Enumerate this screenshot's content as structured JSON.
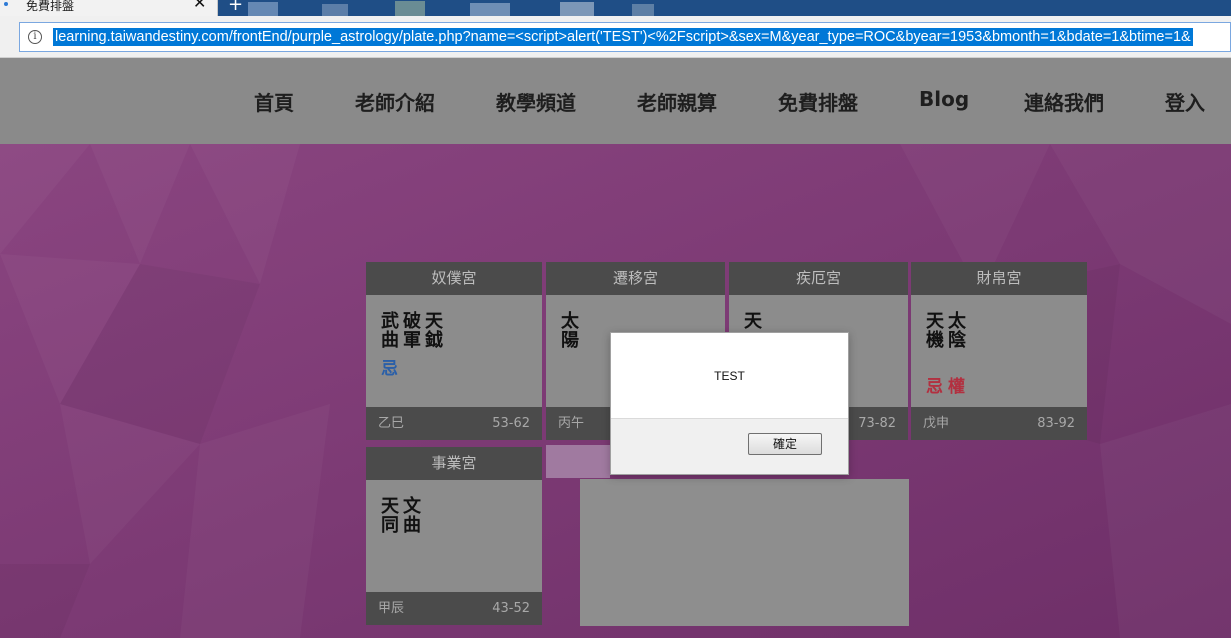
{
  "browser": {
    "tab_title": "免費排盤",
    "tab_close": "✕",
    "new_tab": "+",
    "url": "learning.taiwandestiny.com/frontEnd/purple_astrology/plate.php?name=<script>alert('TEST')<%2Fscript>&sex=M&year_type=ROC&byear=1953&bmonth=1&bdate=1&btime=1&"
  },
  "nav": {
    "items": [
      "首頁",
      "老師介紹",
      "教學頻道",
      "老師親算",
      "免費排盤",
      "Blog",
      "連絡我們",
      "登入"
    ]
  },
  "palaces": [
    {
      "name": "奴僕宮",
      "stars": [
        "武曲",
        "破軍",
        "天鉞"
      ],
      "mutations": [
        "忌"
      ],
      "mutation_color": "blue",
      "ganzhi": "乙巳",
      "ages": "53-62"
    },
    {
      "name": "遷移宮",
      "stars": [
        "太陽"
      ],
      "mutations": [],
      "ganzhi": "丙午",
      "ages": ""
    },
    {
      "name": "疾厄宮",
      "stars": [
        "天"
      ],
      "mutations": [],
      "ganzhi": "",
      "ages": "73-82"
    },
    {
      "name": "財帛宮",
      "stars": [
        "天機",
        "太陰"
      ],
      "mutations": [
        "忌",
        "權"
      ],
      "mutation_color": "red",
      "ganzhi": "戊申",
      "ages": "83-92"
    },
    {
      "name": "事業宮",
      "stars": [
        "天同",
        "文曲"
      ],
      "mutations": [],
      "ganzhi": "甲辰",
      "ages": "43-52"
    }
  ],
  "dialog": {
    "message": "TEST",
    "ok_label": "確定"
  },
  "colors": {
    "background": "#7a3a72",
    "nav": "#8a8a8a",
    "cell": "#8c8c8c",
    "cell_bar": "#4b4b4b",
    "mutation_blue": "#2a5fa8",
    "mutation_red": "#b23040"
  }
}
